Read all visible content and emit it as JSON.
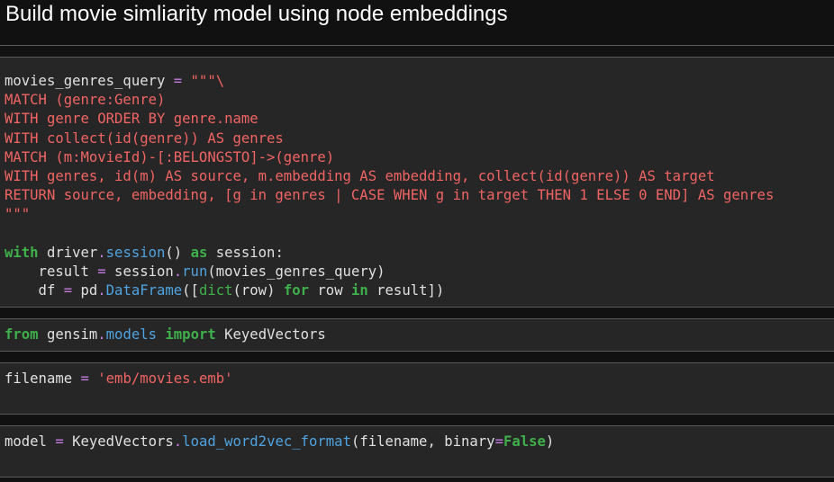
{
  "heading": "Build movie simliarity model using node embeddings",
  "cells": [
    {
      "id": "cell-query",
      "lines": [
        [
          {
            "t": "movies_genres_query ",
            "c": "plain"
          },
          {
            "t": "=",
            "c": "op"
          },
          {
            "t": " ",
            "c": "plain"
          },
          {
            "t": "\"\"\"\\",
            "c": "str"
          }
        ],
        [
          {
            "t": "MATCH (genre:Genre)",
            "c": "str"
          }
        ],
        [
          {
            "t": "WITH genre ORDER BY genre.name",
            "c": "str"
          }
        ],
        [
          {
            "t": "WITH collect(id(genre)) AS genres",
            "c": "str"
          }
        ],
        [
          {
            "t": "MATCH (m:MovieId)-[:BELONGSTO]->(genre)",
            "c": "str"
          }
        ],
        [
          {
            "t": "WITH genres, id(m) AS source, m.embedding AS embedding, collect(id(genre)) AS target",
            "c": "str"
          }
        ],
        [
          {
            "t": "RETURN source, embedding, [g in genres | CASE WHEN g in target THEN 1 ELSE 0 END] AS genres",
            "c": "str"
          }
        ],
        [
          {
            "t": "\"\"\"",
            "c": "str"
          }
        ],
        [
          {
            "t": "",
            "c": "plain"
          }
        ],
        [
          {
            "t": "with",
            "c": "kw"
          },
          {
            "t": " driver",
            "c": "plain"
          },
          {
            "t": ".",
            "c": "op"
          },
          {
            "t": "session",
            "c": "fn"
          },
          {
            "t": "() ",
            "c": "plain"
          },
          {
            "t": "as",
            "c": "kw"
          },
          {
            "t": " session:",
            "c": "plain"
          }
        ],
        [
          {
            "t": "    result ",
            "c": "plain"
          },
          {
            "t": "=",
            "c": "op"
          },
          {
            "t": " session",
            "c": "plain"
          },
          {
            "t": ".",
            "c": "op"
          },
          {
            "t": "run",
            "c": "fn"
          },
          {
            "t": "(movies_genres_query)",
            "c": "plain"
          }
        ],
        [
          {
            "t": "    df ",
            "c": "plain"
          },
          {
            "t": "=",
            "c": "op"
          },
          {
            "t": " pd",
            "c": "plain"
          },
          {
            "t": ".",
            "c": "op"
          },
          {
            "t": "DataFrame",
            "c": "fn"
          },
          {
            "t": "([",
            "c": "plain"
          },
          {
            "t": "dict",
            "c": "bi"
          },
          {
            "t": "(row) ",
            "c": "plain"
          },
          {
            "t": "for",
            "c": "kw"
          },
          {
            "t": " row ",
            "c": "plain"
          },
          {
            "t": "in",
            "c": "kw"
          },
          {
            "t": " result])",
            "c": "plain"
          }
        ]
      ]
    },
    {
      "id": "cell-import",
      "lines": [
        [
          {
            "t": "from",
            "c": "kw"
          },
          {
            "t": " gensim",
            "c": "plain"
          },
          {
            "t": ".",
            "c": "op"
          },
          {
            "t": "models",
            "c": "fn"
          },
          {
            "t": " ",
            "c": "plain"
          },
          {
            "t": "import",
            "c": "kw"
          },
          {
            "t": " KeyedVectors",
            "c": "plain"
          }
        ]
      ]
    },
    {
      "id": "cell-filename",
      "lines": [
        [
          {
            "t": "filename ",
            "c": "plain"
          },
          {
            "t": "=",
            "c": "op"
          },
          {
            "t": " ",
            "c": "plain"
          },
          {
            "t": "'emb/movies.emb'",
            "c": "str"
          }
        ]
      ]
    },
    {
      "id": "cell-model",
      "lines": [
        [
          {
            "t": "model ",
            "c": "plain"
          },
          {
            "t": "=",
            "c": "op"
          },
          {
            "t": " KeyedVectors",
            "c": "plain"
          },
          {
            "t": ".",
            "c": "op"
          },
          {
            "t": "load_word2vec_format",
            "c": "fn"
          },
          {
            "t": "(filename, binary",
            "c": "plain"
          },
          {
            "t": "=",
            "c": "op"
          },
          {
            "t": "False",
            "c": "kw"
          },
          {
            "t": ")",
            "c": "plain"
          }
        ]
      ]
    }
  ],
  "colors": {
    "background": "#111111",
    "cell_background": "#262626",
    "text": "#e0e0e0",
    "keyword": "#3fb04b",
    "operator": "#c57be0",
    "string": "#f06464",
    "function": "#4fa3e0"
  }
}
